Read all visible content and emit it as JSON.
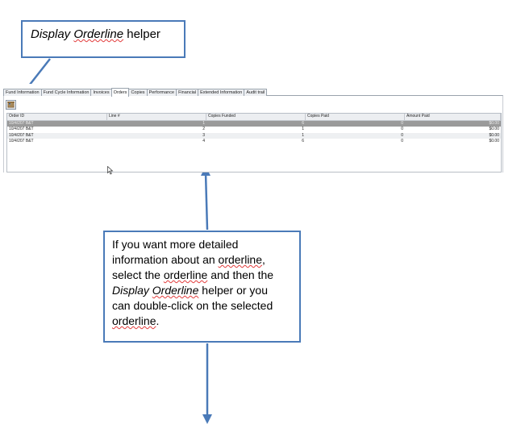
{
  "callout_top": {
    "italic_a": "Display",
    "italic_b": "Orderline",
    "tail": "helper"
  },
  "callout_bottom": {
    "line1": "If you want more detailed",
    "line2_a": "information about an ",
    "line2_b": "orderline",
    "line2_c": ",",
    "line3_a": "select the ",
    "line3_b": "orderline",
    "line3_c": " and then the",
    "line4_a": "Display",
    "line4_b": "Orderline",
    "line4_c": " helper or you",
    "line5": "can double-click on the selected",
    "line6_b": "orderline",
    "line6_c": "."
  },
  "tabs": [
    {
      "label": "Fund Information"
    },
    {
      "label": "Fund Cycle Information"
    },
    {
      "label": "Invoices"
    },
    {
      "label": "Orders",
      "active": true
    },
    {
      "label": "Copies"
    },
    {
      "label": "Performance"
    },
    {
      "label": "Financial"
    },
    {
      "label": "Extended Information"
    },
    {
      "label": "Audit trail"
    }
  ],
  "toolbar": {
    "helper_icon": "orderline-helper-icon"
  },
  "table": {
    "columns": [
      "Order ID",
      "Line #",
      "Copies Funded",
      "Copies Paid",
      "Amount Paid"
    ],
    "rows": [
      [
        "10/4/207 B&T",
        "1",
        "6",
        "0",
        "$0.00"
      ],
      [
        "10/4/207 B&T",
        "2",
        "1",
        "0",
        "$0.00"
      ],
      [
        "10/4/207 B&T",
        "3",
        "1",
        "0",
        "$0.00"
      ],
      [
        "10/4/207 B&T",
        "4",
        "6",
        "0",
        "$0.00"
      ]
    ],
    "selected_row": 0
  },
  "colors": {
    "callout_border": "#4a7ab8",
    "arrow": "#4a7ab8",
    "selection": "#9a9a9a"
  }
}
